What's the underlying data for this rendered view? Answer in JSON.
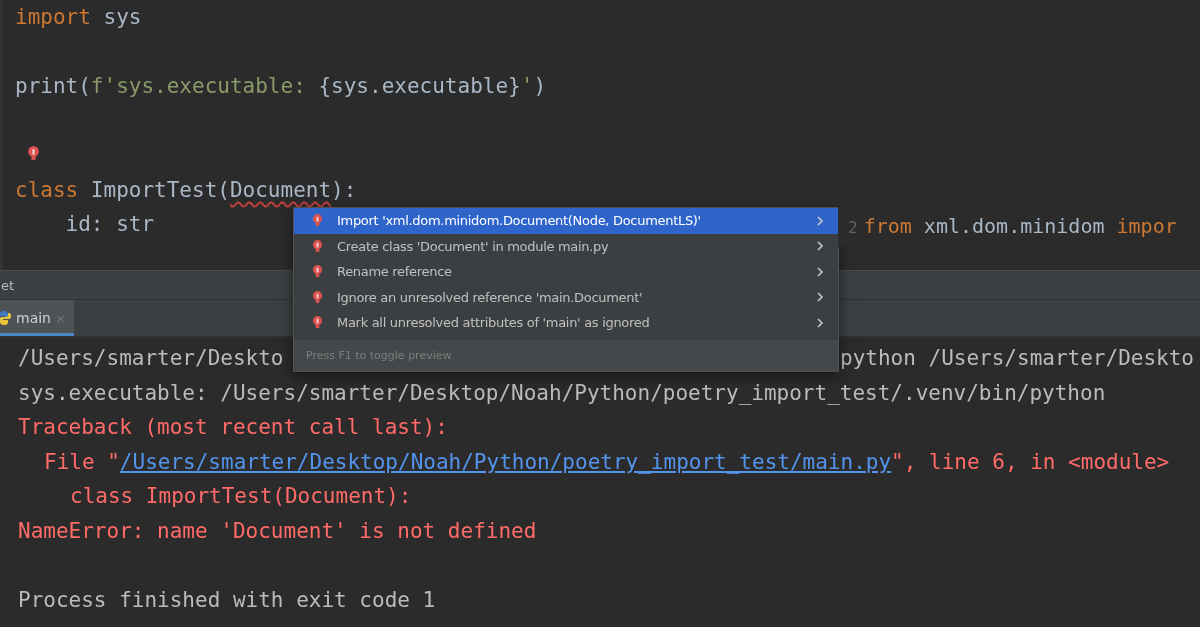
{
  "editor": {
    "lines": [
      {
        "kind": "code",
        "tokens": [
          {
            "kind": "keyword",
            "text": "import"
          },
          {
            "kind": "plain",
            "text": " sys"
          }
        ]
      },
      {
        "kind": "blank"
      },
      {
        "kind": "code",
        "tokens": [
          {
            "kind": "call",
            "text": "print("
          },
          {
            "kind": "string",
            "text": "f'sys.executable: "
          },
          {
            "kind": "plain",
            "text": "{sys.executable}"
          },
          {
            "kind": "string",
            "text": "'"
          },
          {
            "kind": "call",
            "text": ")"
          }
        ]
      },
      {
        "kind": "blank"
      },
      {
        "kind": "hint"
      },
      {
        "kind": "code",
        "tokens": [
          {
            "kind": "keyword",
            "text": "class"
          },
          {
            "kind": "plain",
            "text": " ImportTest("
          },
          {
            "kind": "unresolved",
            "text": "Document"
          },
          {
            "kind": "plain",
            "text": "):"
          }
        ]
      },
      {
        "kind": "code",
        "tokens": [
          {
            "kind": "plain",
            "text": "    id: str"
          }
        ]
      }
    ]
  },
  "intention_popup": {
    "items": [
      {
        "label": "Import 'xml.dom.minidom.Document(Node, DocumentLS)'",
        "selected": true
      },
      {
        "label": "Create class 'Document' in module main.py",
        "selected": false
      },
      {
        "label": "Rename reference",
        "selected": false
      },
      {
        "label": "Ignore an unresolved reference 'main.Document'",
        "selected": false
      },
      {
        "label": "Mark all unresolved attributes of 'main' as ignored",
        "selected": false
      }
    ],
    "footer": "Press F1 to toggle preview",
    "preview": {
      "line_number": "2",
      "tokens": [
        {
          "kind": "keyword",
          "text": "from"
        },
        {
          "kind": "plain",
          "text": " xml.dom.minidom "
        },
        {
          "kind": "keyword",
          "text": "impor"
        }
      ]
    }
  },
  "tool_window": {
    "title": "et",
    "tabs": [
      {
        "label": "main",
        "close": "×",
        "selected": true
      }
    ]
  },
  "console": {
    "lines": [
      {
        "kind": "covered",
        "text": "/Users/smarter/Deskto",
        "text_right": "python /Users/smarter/Deskto"
      },
      {
        "kind": "stdout",
        "text": "sys.executable: /Users/smarter/Desktop/Noah/Python/poetry_import_test/.venv/bin/python"
      },
      {
        "kind": "error",
        "text": "Traceback (most recent call last):"
      },
      {
        "kind": "traceback_file",
        "prefix": "File \"",
        "link": "/Users/smarter/Desktop/Noah/Python/poetry_import_test/main.py",
        "suffix": "\", line 6, in <module>"
      },
      {
        "kind": "traceback_code",
        "text": "class ImportTest(Document):"
      },
      {
        "kind": "error",
        "text": "NameError: name 'Document' is not defined"
      },
      {
        "kind": "blank"
      },
      {
        "kind": "stdout",
        "text": "Process finished with exit code 1"
      }
    ]
  }
}
